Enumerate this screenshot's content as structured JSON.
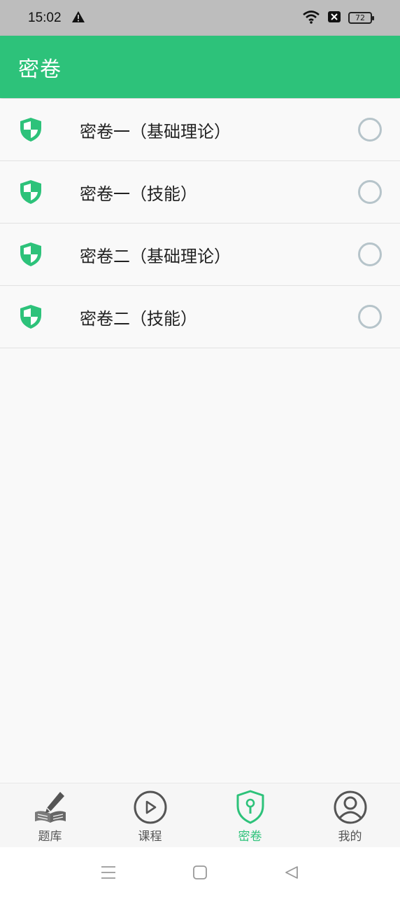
{
  "status_bar": {
    "time": "15:02",
    "battery": "72",
    "icons": [
      "warning-icon",
      "wifi-icon",
      "sim-off-icon",
      "battery-icon"
    ]
  },
  "app_bar": {
    "title": "密卷",
    "color": "#2dc27a"
  },
  "list": {
    "items": [
      {
        "label": "密卷一（基础理论）",
        "icon": "shield-icon",
        "selected": false
      },
      {
        "label": "密卷一（技能）",
        "icon": "shield-icon",
        "selected": false
      },
      {
        "label": "密卷二（基础理论）",
        "icon": "shield-icon",
        "selected": false
      },
      {
        "label": "密卷二（技能）",
        "icon": "shield-icon",
        "selected": false
      }
    ]
  },
  "bottom_nav": {
    "items": [
      {
        "label": "题库",
        "icon": "book-pen-icon",
        "active": false
      },
      {
        "label": "课程",
        "icon": "play-circle-icon",
        "active": false
      },
      {
        "label": "密卷",
        "icon": "shield-lock-icon",
        "active": true
      },
      {
        "label": "我的",
        "icon": "user-icon",
        "active": false
      }
    ],
    "active_color": "#2dc27a",
    "inactive_color": "#555555"
  },
  "system_nav": {
    "icons": [
      "menu-icon",
      "home-icon",
      "back-icon"
    ]
  }
}
